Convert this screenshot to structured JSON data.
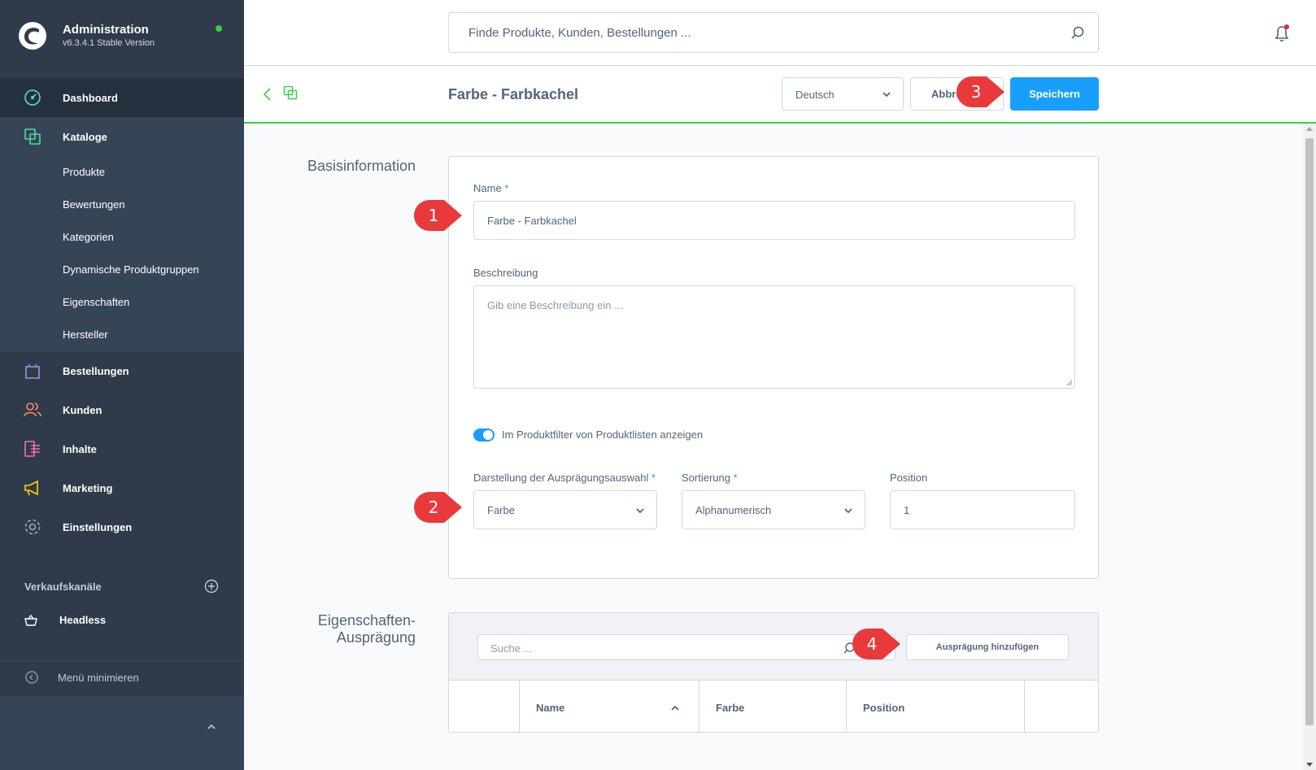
{
  "brand": {
    "title": "Administration",
    "version": "v6.3.4.1 Stable Version",
    "status_color": "#37d046"
  },
  "nav": {
    "dashboard": "Dashboard",
    "catalogs": "Kataloge",
    "catalog_items": [
      "Produkte",
      "Bewertungen",
      "Kategorien",
      "Dynamische Produktgruppen",
      "Eigenschaften",
      "Hersteller"
    ],
    "orders": "Bestellungen",
    "customers": "Kunden",
    "content": "Inhalte",
    "marketing": "Marketing",
    "settings": "Einstellungen",
    "sales_channels_title": "Verkaufskanäle",
    "sales_channels": [
      "Headless"
    ],
    "minimize": "Menü minimieren"
  },
  "search": {
    "placeholder": "Finde Produkte, Kunden, Bestellungen ..."
  },
  "smartbar": {
    "title": "Farbe - Farbkachel",
    "language": "Deutsch",
    "cancel_label": "Abbrechen",
    "save_label": "Speichern"
  },
  "basic_info": {
    "section_title": "Basisinformation",
    "name_label": "Name",
    "required_mark": "*",
    "name_value": "Farbe - Farbkachel",
    "description_label": "Beschreibung",
    "description_placeholder": "Gib eine Beschreibung ein ...",
    "filter_toggle_label": "Im Produktfilter von Produktlisten anzeigen",
    "filter_toggle_on": true,
    "display_type_label": "Darstellung der Ausprägungsauswahl",
    "display_type_value": "Farbe",
    "sorting_label": "Sortierung",
    "sorting_value": "Alphanumerisch",
    "position_label": "Position",
    "position_value": "1"
  },
  "options": {
    "section_title_line1": "Eigenschaften-",
    "section_title_line2": "Ausprägung",
    "search_placeholder": "Suche ...",
    "add_button": "Ausprägung hinzufügen",
    "columns": [
      "Name",
      "Farbe",
      "Position"
    ]
  },
  "callouts": [
    "1",
    "2",
    "3",
    "4"
  ],
  "colors": {
    "accent": "#189eff",
    "sidebar": "#2f3b4a",
    "callout": "#e8393d",
    "active_line": "#37d046"
  }
}
